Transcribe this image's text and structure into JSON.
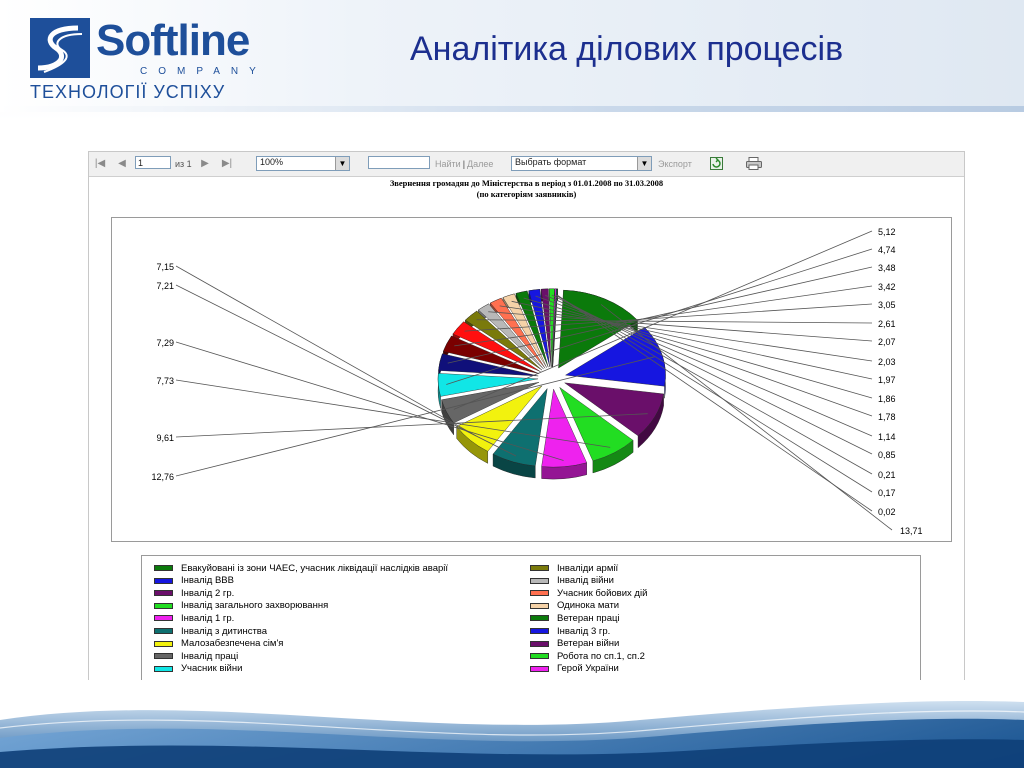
{
  "logo": {
    "word": "Softline",
    "company": "COMPANY",
    "tagline": "ТЕХНОЛОГІЇ УСПІХУ"
  },
  "slide_title": "Аналітика ділових процесів",
  "toolbar": {
    "page_value": "1",
    "page_of": "из 1",
    "zoom": "100%",
    "search_value": "",
    "find_label": "Найти",
    "separator": "|",
    "next_label": "Далее",
    "format_select": "Выбрать формат",
    "export_label": "Экспорт"
  },
  "report": {
    "title_line1": "Звернення громадян до Міністерства в період з 01.01.2008 по 31.03.2008",
    "title_line2": "(по категоріям заявників)"
  },
  "chart_data": {
    "type": "pie",
    "values": [
      13.71,
      12.76,
      9.61,
      7.73,
      7.29,
      7.21,
      7.15,
      5.12,
      4.74,
      3.48,
      3.42,
      3.05,
      2.61,
      2.07,
      2.03,
      1.97,
      1.86,
      1.78,
      1.14,
      0.85,
      0.21,
      0.17,
      0.02
    ],
    "labels": [
      "13,71",
      "12,76",
      "9,61",
      "7,73",
      "7,29",
      "7,21",
      "7,15",
      "5,12",
      "4,74",
      "3,48",
      "3,42",
      "3,05",
      "2,61",
      "2,07",
      "2,03",
      "1,97",
      "1,86",
      "1,78",
      "1,14",
      "0,85",
      "0,21",
      "0,17",
      "0,02"
    ],
    "colors": [
      "#0b7a0b",
      "#1616e0",
      "#6a0f6a",
      "#22dd22",
      "#ee22ee",
      "#0e7070",
      "#f2f20e",
      "#666666",
      "#11e6e6",
      "#10107a",
      "#7a0000",
      "#ff0f0f",
      "#7a7a0b",
      "#b8b8b8",
      "#ff7050",
      "#f5d2a8",
      "#0b7a0b",
      "#1616e0",
      "#6a0f6a",
      "#22dd22",
      "#ee22ee",
      "#0e7070",
      "#f2f20e"
    ]
  },
  "legend": {
    "left": [
      {
        "label": "Евакуйовані із зони ЧАЕС, учасник ліквідації наслідків аварії",
        "color": "#0b7a0b"
      },
      {
        "label": "Інвалід ВВВ",
        "color": "#1616e0"
      },
      {
        "label": "Інвалід 2 гр.",
        "color": "#6a0f6a"
      },
      {
        "label": "Інвалід загального захворювання",
        "color": "#22dd22"
      },
      {
        "label": "Інвалід 1 гр.",
        "color": "#ee22ee"
      },
      {
        "label": "Інвалід з дитинства",
        "color": "#0e7070"
      },
      {
        "label": "Малозабезпечена сім'я",
        "color": "#f2f20e"
      },
      {
        "label": "Інвалід праці",
        "color": "#666666"
      },
      {
        "label": "Учасник війни",
        "color": "#11e6e6"
      }
    ],
    "right": [
      {
        "label": "Інваліди армії",
        "color": "#7a7a0b"
      },
      {
        "label": "Інвалід війни",
        "color": "#b8b8b8"
      },
      {
        "label": "Учасник бойових дій",
        "color": "#ff7050"
      },
      {
        "label": "Одинока мати",
        "color": "#f5d2a8"
      },
      {
        "label": "Ветеран праці",
        "color": "#0b7a0b"
      },
      {
        "label": "Інвалід 3 гр.",
        "color": "#1616e0"
      },
      {
        "label": "Ветеран війни",
        "color": "#6a0f6a"
      },
      {
        "label": "Робота по сп.1, сп.2",
        "color": "#22dd22"
      },
      {
        "label": "Герой України",
        "color": "#ee22ee"
      }
    ]
  },
  "colors": {
    "brand": "#1e4f9a",
    "title": "#1c2f8f"
  }
}
